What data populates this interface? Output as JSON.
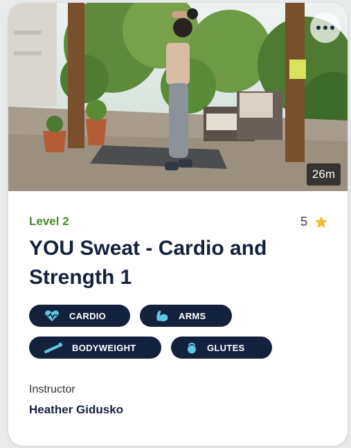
{
  "workout": {
    "duration": "26m",
    "level": "Level 2",
    "rating": "5",
    "title": "YOU Sweat - Cardio and Strength 1",
    "tags": [
      {
        "label": "CARDIO",
        "icon": "heart-pulse-icon"
      },
      {
        "label": "ARMS",
        "icon": "flexed-arm-icon"
      },
      {
        "label": "BODYWEIGHT",
        "icon": "incline-body-icon"
      },
      {
        "label": "GLUTES",
        "icon": "kettlebell-icon"
      }
    ],
    "instructor_label": "Instructor",
    "instructor_name": "Heather Gidusko"
  },
  "colors": {
    "navy": "#14213d",
    "level_green": "#4b8a2c",
    "star": "#f5b830"
  },
  "icons": [
    "more-dots-icon",
    "star-icon"
  ]
}
